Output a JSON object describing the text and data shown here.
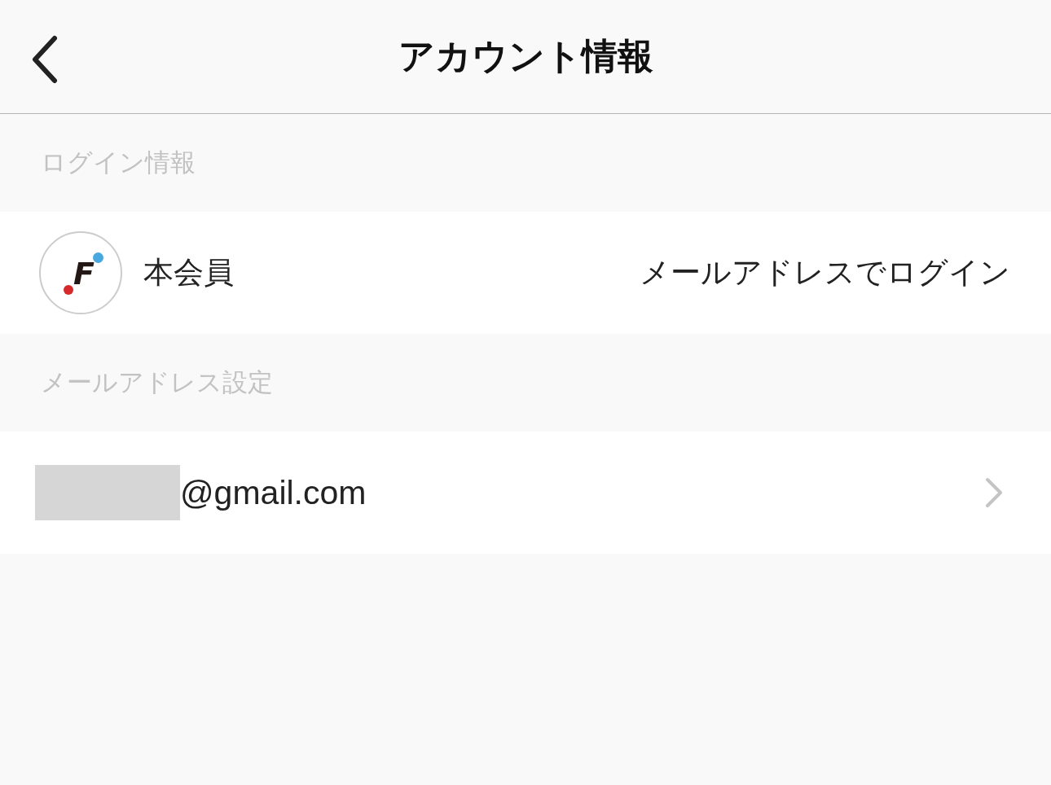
{
  "header": {
    "title": "アカウント情報"
  },
  "sections": [
    {
      "kind": "login",
      "label": "ログイン情報",
      "logo_text": "F",
      "member": "本会員",
      "method": "メールアドレスでログイン"
    },
    {
      "kind": "email",
      "label": "メールアドレス設定",
      "email_suffix": "@gmail.com"
    }
  ]
}
